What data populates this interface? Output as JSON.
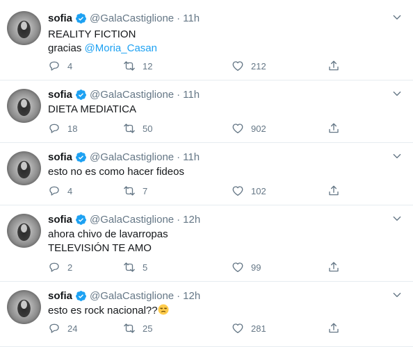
{
  "tweets": [
    {
      "name": "sofia",
      "handle": "@GalaCastiglione",
      "dot": "·",
      "time": "11h",
      "line1": "REALITY FICTION",
      "line2_prefix": "gracias ",
      "line2_mention": "@Moria_Casan",
      "replies": "4",
      "retweets": "12",
      "likes": "212"
    },
    {
      "name": "sofia",
      "handle": "@GalaCastiglione",
      "dot": "·",
      "time": "11h",
      "line1": "DIETA MEDIATICA",
      "replies": "18",
      "retweets": "50",
      "likes": "902"
    },
    {
      "name": "sofia",
      "handle": "@GalaCastiglione",
      "dot": "·",
      "time": "11h",
      "line1": "esto no es como hacer fideos",
      "replies": "4",
      "retweets": "7",
      "likes": "102"
    },
    {
      "name": "sofia",
      "handle": "@GalaCastiglione",
      "dot": "·",
      "time": "12h",
      "line1": "ahora chivo de lavarropas",
      "line2": "TELEVISIÓN TE AMO",
      "replies": "2",
      "retweets": "5",
      "likes": "99"
    },
    {
      "name": "sofia",
      "handle": "@GalaCastiglione",
      "dot": "·",
      "time": "12h",
      "line1": "esto es rock nacional??",
      "emoji": "unamused-face-emoji",
      "replies": "24",
      "retweets": "25",
      "likes": "281"
    }
  ],
  "icons": {
    "verified": "verified-badge-icon",
    "caret": "chevron-down-icon",
    "reply": "reply-icon",
    "retweet": "retweet-icon",
    "like": "heart-icon",
    "share": "share-icon"
  },
  "colors": {
    "accent": "#1da1f2",
    "muted": "#657786",
    "text": "#14171a",
    "divider": "#e6ecf0"
  }
}
